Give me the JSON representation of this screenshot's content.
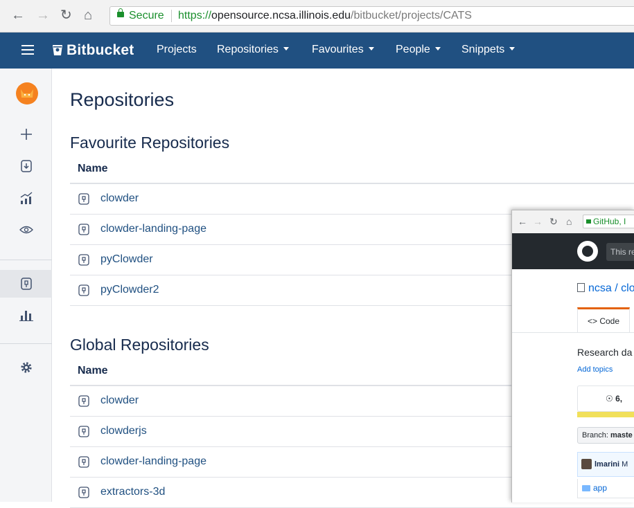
{
  "browser": {
    "secure_label": "Secure",
    "url_protocol": "https://",
    "url_host": "opensource.ncsa.illinois.edu",
    "url_path": "/bitbucket/projects/CATS"
  },
  "header": {
    "logo": "Bitbucket",
    "nav": [
      {
        "label": "Projects",
        "dropdown": false
      },
      {
        "label": "Repositories",
        "dropdown": true
      },
      {
        "label": "Favourites",
        "dropdown": true
      },
      {
        "label": "People",
        "dropdown": true
      },
      {
        "label": "Snippets",
        "dropdown": true
      }
    ],
    "brand_color": "#205081"
  },
  "sidebar": {
    "icons": [
      "cat-avatar",
      "plus-icon",
      "pull-request-icon",
      "chart-up-icon",
      "eye-icon",
      "repository-icon",
      "bar-chart-icon",
      "gear-icon"
    ],
    "active": "repository-icon"
  },
  "main": {
    "title": "Repositories",
    "favourites": {
      "title": "Favourite Repositories",
      "column": "Name",
      "repos": [
        "clowder",
        "clowder-landing-page",
        "pyClowder",
        "pyClowder2"
      ]
    },
    "global": {
      "title": "Global Repositories",
      "column": "Name",
      "repos": [
        "clowder",
        "clowderjs",
        "clowder-landing-page",
        "extractors-3d"
      ]
    }
  },
  "github_window": {
    "address": "GitHub, I",
    "search_placeholder": "This re",
    "breadcrumb": "ncsa / clo",
    "tab_code": "<> Code",
    "description": "Research da",
    "add_topics": "Add topics",
    "stats": "6,",
    "branch_label": "Branch:",
    "branch_name": "maste",
    "commit_user": "lmarini",
    "commit_rest": "M",
    "file": "app"
  }
}
